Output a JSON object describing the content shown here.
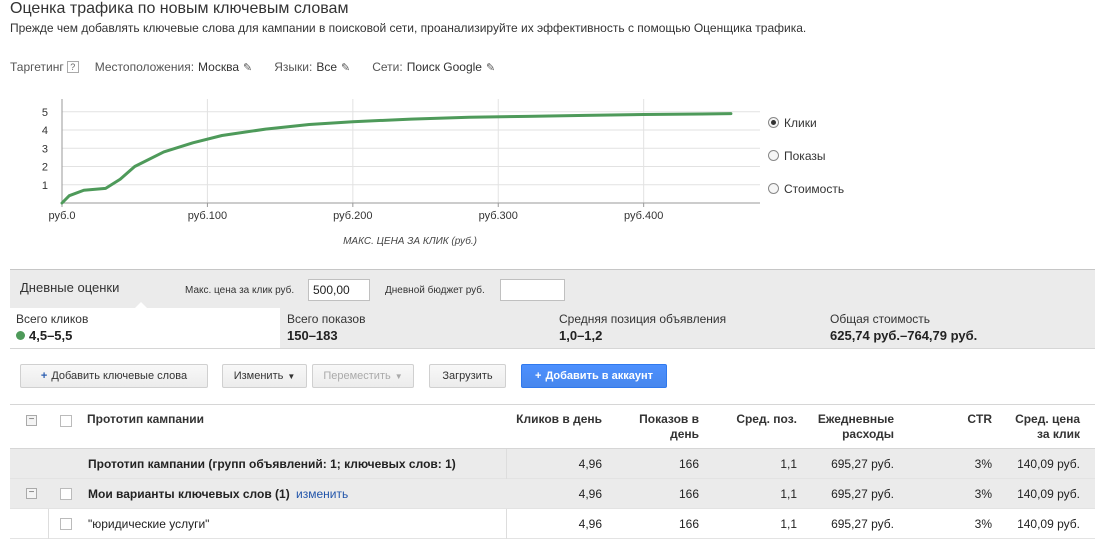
{
  "page": {
    "title": "Оценка трафика по новым ключевым словам",
    "subtitle": "Прежде чем добавлять ключевые слова для кампании в поисковой сети, проанализируйте их эффективность с помощью Оценщика трафика."
  },
  "targeting": {
    "label": "Таргетинг",
    "help": "?",
    "locations_label": "Местоположения:",
    "locations_value": "Москва",
    "languages_label": "Языки:",
    "languages_value": "Все",
    "networks_label": "Сети:",
    "networks_value": "Поиск Google"
  },
  "chart_data": {
    "type": "line",
    "xlabel": "МАКС. ЦЕНА ЗА КЛИК (руб.)",
    "ylabel": "",
    "x_ticks": [
      "руб.0",
      "руб.100",
      "руб.200",
      "руб.300",
      "руб.400"
    ],
    "y_ticks": [
      "1",
      "2",
      "3",
      "4",
      "5"
    ],
    "xlim": [
      0,
      480
    ],
    "ylim": [
      0,
      5.7
    ],
    "grid": true,
    "color": "#4e9a5a",
    "series": [
      {
        "x": [
          0,
          5,
          15,
          30,
          40,
          50,
          70,
          90,
          110,
          140,
          170,
          200,
          240,
          280,
          320,
          360,
          400,
          440,
          460
        ],
        "values": [
          0,
          0.4,
          0.7,
          0.8,
          1.3,
          2.0,
          2.8,
          3.3,
          3.7,
          4.05,
          4.3,
          4.45,
          4.6,
          4.7,
          4.75,
          4.8,
          4.85,
          4.88,
          4.9
        ]
      }
    ]
  },
  "legend": {
    "options": [
      {
        "label": "Клики",
        "selected": true
      },
      {
        "label": "Показы",
        "selected": false
      },
      {
        "label": "Стоимость",
        "selected": false
      }
    ]
  },
  "daily": {
    "title": "Дневные оценки",
    "max_cpc_label": "Макс. цена за клик руб.",
    "max_cpc_value": "500,00",
    "budget_label": "Дневной бюджет руб.",
    "budget_value": ""
  },
  "stats": [
    {
      "label": "Всего кликов",
      "value": "4,5–5,5"
    },
    {
      "label": "Всего показов",
      "value": "150–183"
    },
    {
      "label": "Средняя позиция объявления",
      "value": "1,0–1,2"
    },
    {
      "label": "Общая стоимость",
      "value": "625,74 руб.–764,79 руб."
    }
  ],
  "toolbar": {
    "add_keywords": "Добавить ключевые слова",
    "edit": "Изменить",
    "move": "Переместить",
    "upload": "Загрузить",
    "add_to_account": "Добавить в аккаунт"
  },
  "table": {
    "headers": {
      "campaign": "Прототип кампании",
      "clicks_l1": "Кликов в день",
      "impr_l1": "Показов в",
      "impr_l2": "день",
      "pos": "Сред. поз.",
      "cost_l1": "Ежедневные",
      "cost_l2": "расходы",
      "ctr": "CTR",
      "cpc_l1": "Сред. цена",
      "cpc_l2": "за клик"
    },
    "rows": [
      {
        "name": "Прототип кампании (групп объявлений: 1; ключевых слов: 1)",
        "link": "",
        "clicks": "4,96",
        "impr": "166",
        "pos": "1,1",
        "cost": "695,27 руб.",
        "ctr": "3%",
        "cpc": "140,09 руб."
      },
      {
        "name": "Мои варианты ключевых слов (1)",
        "link": "изменить",
        "clicks": "4,96",
        "impr": "166",
        "pos": "1,1",
        "cost": "695,27 руб.",
        "ctr": "3%",
        "cpc": "140,09 руб."
      },
      {
        "name": "\"юридические услуги\"",
        "link": "",
        "clicks": "4,96",
        "impr": "166",
        "pos": "1,1",
        "cost": "695,27 руб.",
        "ctr": "3%",
        "cpc": "140,09 руб."
      }
    ]
  }
}
